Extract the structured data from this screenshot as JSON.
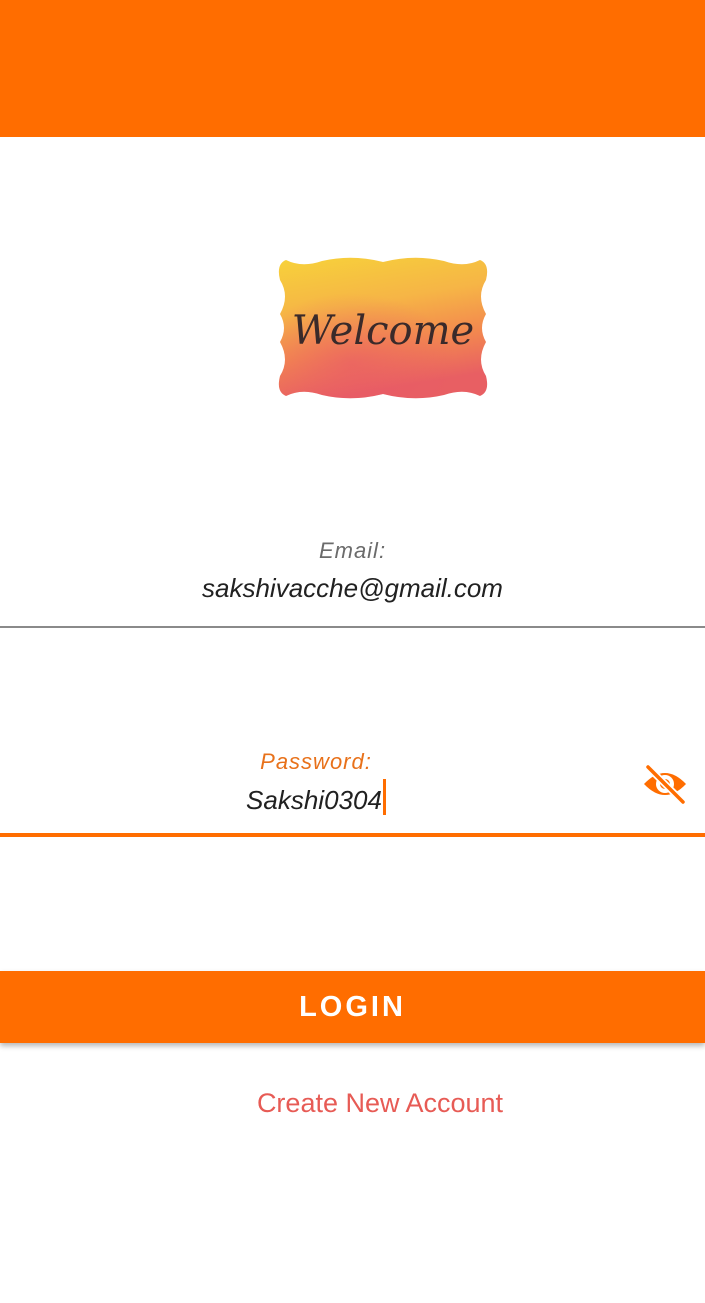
{
  "header": {
    "color": "#FF6D00"
  },
  "logo": {
    "text": "Welcome"
  },
  "email": {
    "label": "Email:",
    "value": "sakshivacche@gmail.com"
  },
  "password": {
    "label": "Password:",
    "value": "Sakshi0304",
    "toggle_icon": "eye-off-icon"
  },
  "login": {
    "label": "LOGIN"
  },
  "create_account": {
    "label": "Create New Account"
  },
  "colors": {
    "accent": "#FF6D00",
    "label_focused": "#E8711A",
    "link": "#E75B55",
    "label_default": "#6b6b6b"
  }
}
